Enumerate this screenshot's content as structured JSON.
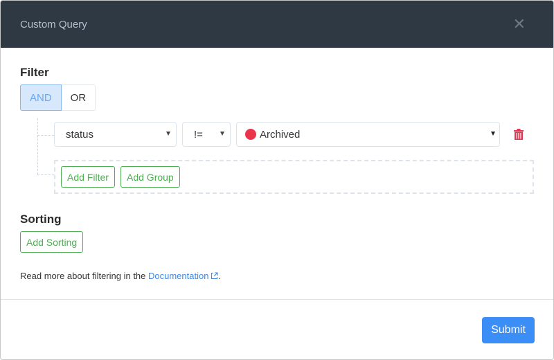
{
  "dialog": {
    "title": "Custom Query",
    "close_label": "✕"
  },
  "filter": {
    "title": "Filter",
    "logic": {
      "options": [
        "AND",
        "OR"
      ],
      "selected": "AND"
    },
    "rules": [
      {
        "field": "status",
        "operator": "!=",
        "value": "Archived",
        "value_color": "#ea3449"
      }
    ],
    "add_filter_label": "Add Filter",
    "add_group_label": "Add Group"
  },
  "sorting": {
    "title": "Sorting",
    "add_sorting_label": "Add Sorting"
  },
  "help": {
    "prefix": "Read more about filtering in the ",
    "link_text": "Documentation",
    "suffix": "."
  },
  "footer": {
    "submit_label": "Submit"
  },
  "colors": {
    "header_bg": "#2f3944",
    "primary": "#3c8ef7",
    "success": "#4caf50",
    "danger": "#ea3449"
  }
}
